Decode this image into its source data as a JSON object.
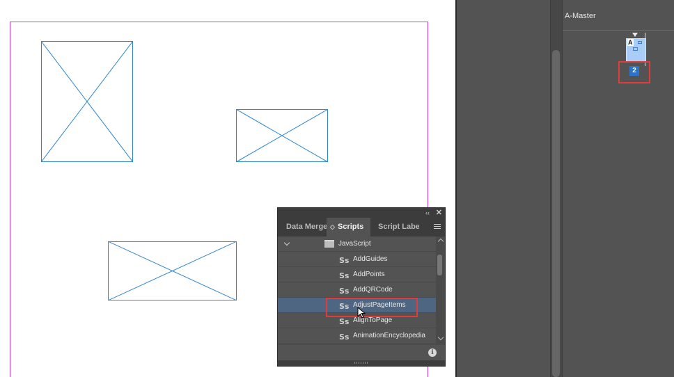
{
  "pages_panel": {
    "master_label": "A-Master",
    "thumb_prefix": "A",
    "page_number": "2"
  },
  "scripts_panel": {
    "tabs": [
      {
        "label": "Data Merge"
      },
      {
        "label": "Scripts"
      },
      {
        "label": "Script Label"
      }
    ],
    "folder": "JavaScript",
    "scripts": [
      {
        "label": "AddGuides"
      },
      {
        "label": "AddPoints"
      },
      {
        "label": "AddQRCode"
      },
      {
        "label": "AdjustPageItems",
        "selected": true
      },
      {
        "label": "AlignToPage"
      },
      {
        "label": "AnimationEncyclopedia"
      }
    ],
    "info": "i",
    "collapse": "‹‹",
    "close": "✕"
  },
  "colors": {
    "frame_stroke": "#2e86d1",
    "page_margin": "#c638c6",
    "selection": "#4e6681",
    "highlight": "#e03c3c"
  }
}
